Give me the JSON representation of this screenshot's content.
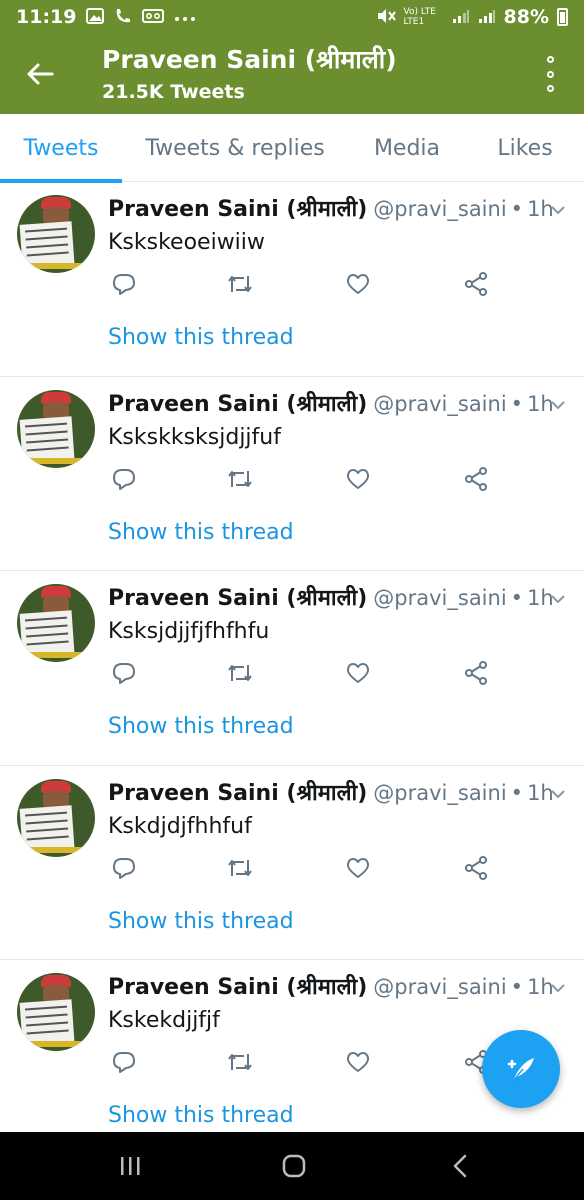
{
  "status_bar": {
    "time": "11:19",
    "network_label": "Vo) LTE LTE1",
    "battery": "88%",
    "notification_icons": [
      "gallery-icon",
      "call-icon",
      "voicemail-icon",
      "more-dots-icon"
    ]
  },
  "app_bar": {
    "title": "Praveen Saini (श्रीमाली)",
    "subtitle": "21.5K Tweets",
    "bar_color": "#6b8f2f"
  },
  "tabs": [
    {
      "label": "Tweets",
      "active": true
    },
    {
      "label": "Tweets & replies",
      "active": false
    },
    {
      "label": "Media",
      "active": false
    },
    {
      "label": "Likes",
      "active": false
    }
  ],
  "tweets": [
    {
      "name": "Praveen Saini (श्रीमाली)",
      "handle": "@pravi_saini",
      "sep": "•",
      "time": "1h",
      "text": "Kskskeoeiwiiw",
      "thread_label": "Show this thread"
    },
    {
      "name": "Praveen Saini (श्रीमाली)",
      "handle": "@pravi_saini",
      "sep": "•",
      "time": "1h",
      "text": "Kskskksksjdjjfuf",
      "thread_label": "Show this thread"
    },
    {
      "name": "Praveen Saini (श्रीमाली)",
      "handle": "@pravi_saini",
      "sep": "•",
      "time": "1h",
      "text": "Ksksjdjjfjfhfhfu",
      "thread_label": "Show this thread"
    },
    {
      "name": "Praveen Saini (श्रीमाली)",
      "handle": "@pravi_saini",
      "sep": "•",
      "time": "1h",
      "text": "Kskdjdjfhhfuf",
      "thread_label": "Show this thread"
    },
    {
      "name": "Praveen Saini (श्रीमाली)",
      "handle": "@pravi_saini",
      "sep": "•",
      "time": "1h",
      "text": "Kskekdjjfjf",
      "thread_label": "Show this thread"
    }
  ],
  "colors": {
    "accent": "#1da1f2",
    "link": "#1b95e0",
    "muted": "#657786",
    "divider": "#e1e8ed"
  },
  "icons": {
    "reply": "reply-icon",
    "retweet": "retweet-icon",
    "like": "like-icon",
    "share": "share-icon",
    "compose": "compose-tweet-icon"
  }
}
